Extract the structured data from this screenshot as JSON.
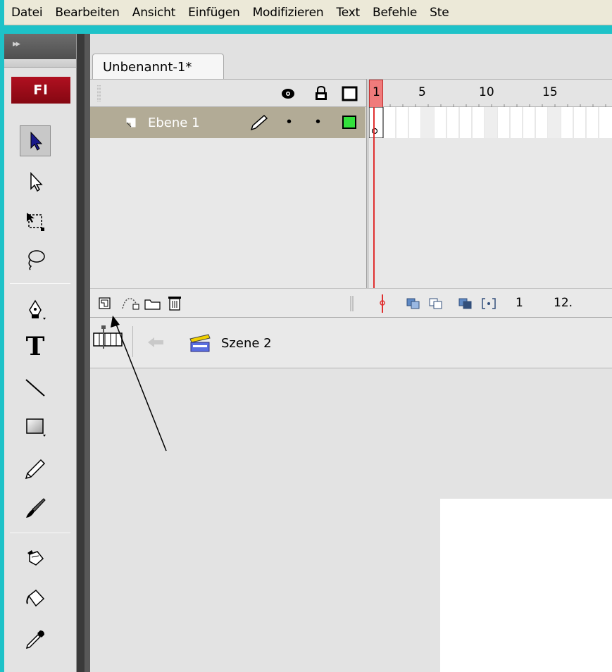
{
  "menubar": {
    "items": [
      "Datei",
      "Bearbeiten",
      "Ansicht",
      "Einfügen",
      "Modifizieren",
      "Text",
      "Befehle",
      "Ste"
    ]
  },
  "tools": {
    "collapse_glyph": "▸▸",
    "logo": "Fl",
    "items": [
      {
        "name": "selection-tool-icon",
        "selected": true
      },
      {
        "name": "subselection-tool-icon"
      },
      {
        "name": "free-transform-tool-icon"
      },
      {
        "name": "lasso-tool-icon"
      },
      {
        "name": "pen-tool-icon"
      },
      {
        "name": "text-tool-icon",
        "glyph": "T"
      },
      {
        "name": "line-tool-icon"
      },
      {
        "name": "rectangle-tool-icon"
      },
      {
        "name": "pencil-tool-icon"
      },
      {
        "name": "brush-tool-icon"
      },
      {
        "name": "ink-bottle-tool-icon"
      },
      {
        "name": "paint-bucket-tool-icon"
      },
      {
        "name": "eyedropper-tool-icon"
      }
    ]
  },
  "document": {
    "tab_title": "Unbenannt-1*"
  },
  "timeline": {
    "frame_numbers": [
      "1",
      "5",
      "10",
      "15"
    ],
    "layer": {
      "name": "Ebene 1",
      "color": "#33e03c"
    },
    "footer": {
      "current_frame": "1",
      "frame_rate": "12."
    }
  },
  "scene": {
    "name": "Szene 2"
  },
  "colors": {
    "background": "#1ec2c8",
    "playhead": "#e03030",
    "layer_highlight": "#b2ab96",
    "logo_red": "#9b0d18"
  }
}
